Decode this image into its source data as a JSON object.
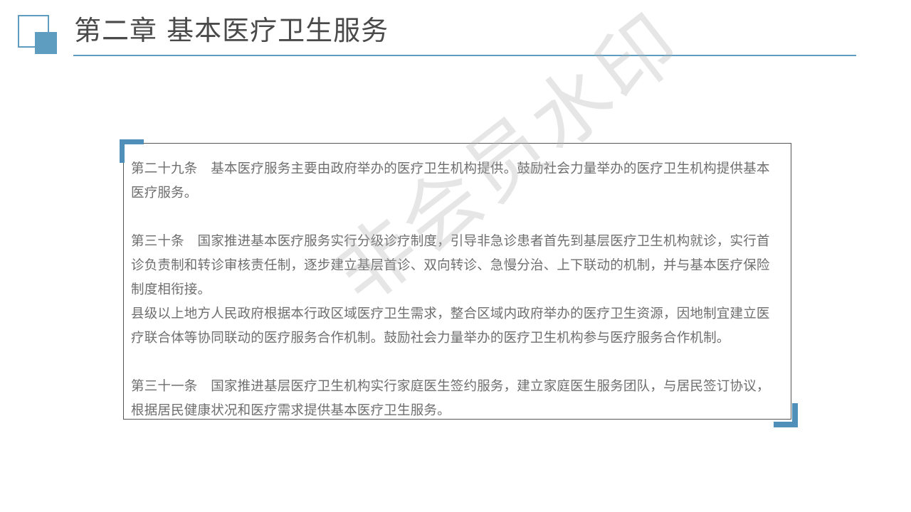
{
  "header": {
    "title": "第二章 基本医疗卫生服务"
  },
  "colors": {
    "accent": "#5f9dc0",
    "corner": "#4f8fba",
    "text": "#6e6e6e",
    "title": "#4a4a4a"
  },
  "content": {
    "paragraphs": [
      "第二十九条　基本医疗服务主要由政府举办的医疗卫生机构提供。鼓励社会力量举办的医疗卫生机构提供基本医疗服务。",
      "",
      "第三十条　国家推进基本医疗服务实行分级诊疗制度，引导非急诊患者首先到基层医疗卫生机构就诊，实行首诊负责制和转诊审核责任制，逐步建立基层首诊、双向转诊、急慢分治、上下联动的机制，并与基本医疗保险制度相衔接。",
      "县级以上地方人民政府根据本行政区域医疗卫生需求，整合区域内政府举办的医疗卫生资源，因地制宜建立医疗联合体等协同联动的医疗服务合作机制。鼓励社会力量举办的医疗卫生机构参与医疗服务合作机制。",
      "",
      "第三十一条　国家推进基层医疗卫生机构实行家庭医生签约服务，建立家庭医生服务团队，与居民签订协议，根据居民健康状况和医疗需求提供基本医疗卫生服务。"
    ]
  },
  "watermark": {
    "text": "非会员水印"
  }
}
